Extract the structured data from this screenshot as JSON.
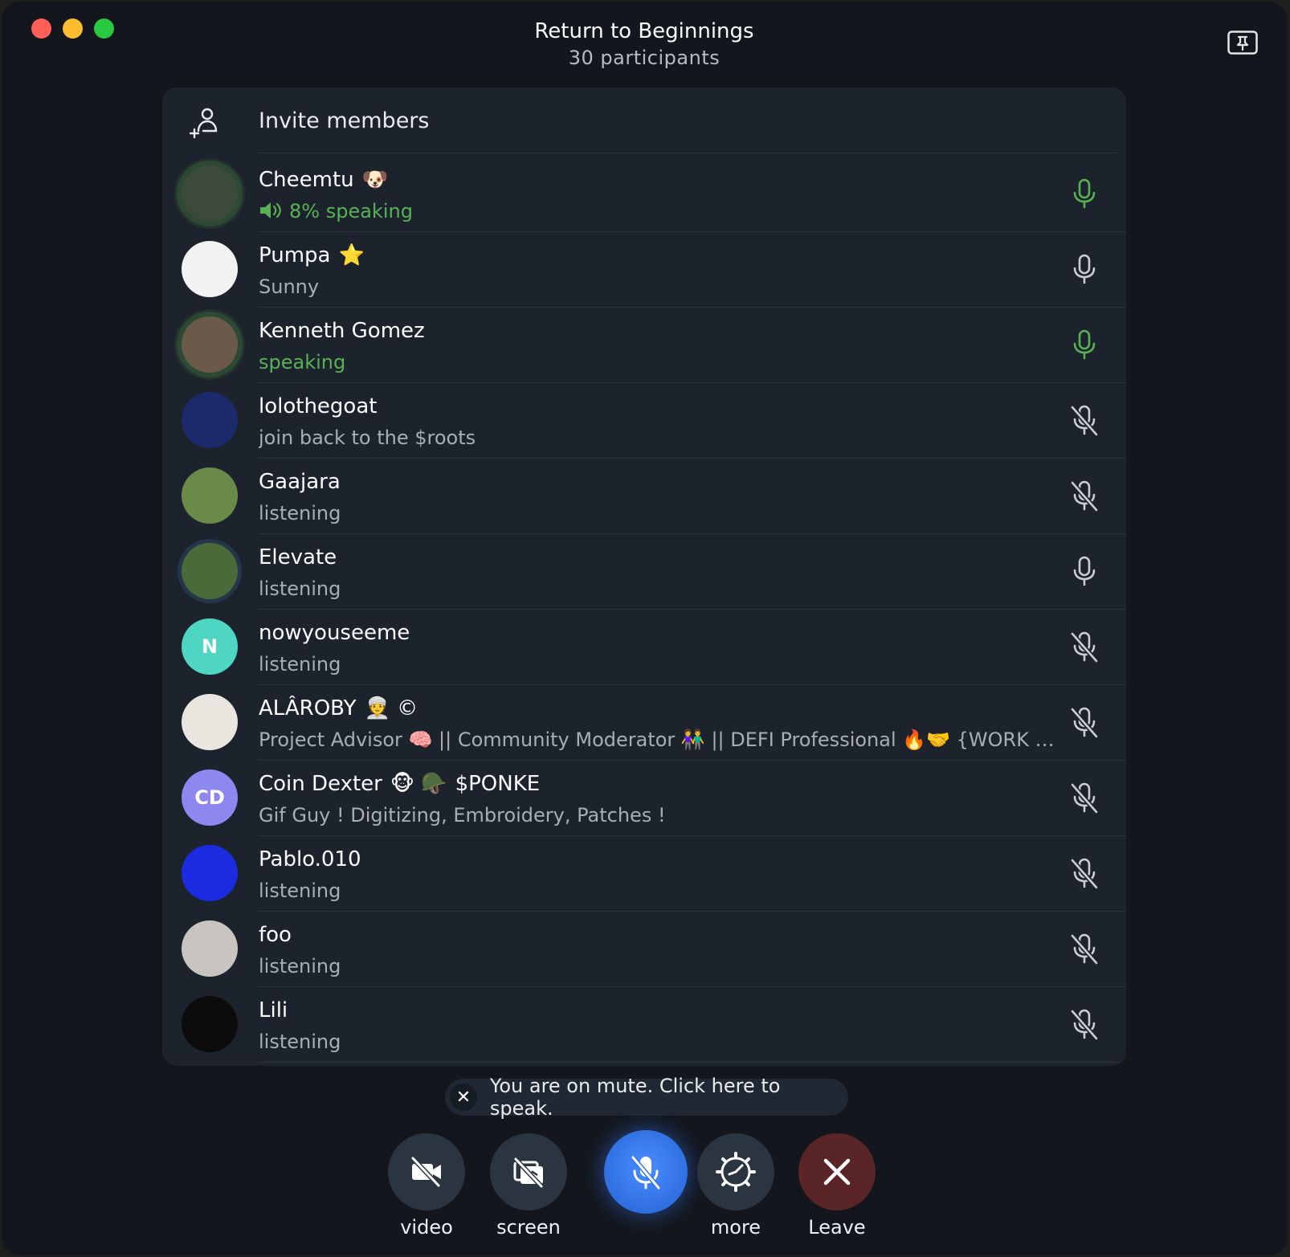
{
  "window": {
    "title": "Return to Beginnings",
    "subtitle": "30 participants"
  },
  "invite": {
    "label": "Invite members"
  },
  "participants": [
    {
      "name": "Cheemtu",
      "emoji": "🐶",
      "status": "8% speaking",
      "state": "speaking",
      "mic": "active",
      "avatar_color": "#3b4a3a",
      "initials": ""
    },
    {
      "name": "Pumpa",
      "emoji": "⭐",
      "status": "Sunny",
      "state": "idle",
      "mic": "on",
      "avatar_color": "#f2f2f2",
      "initials": ""
    },
    {
      "name": "Kenneth Gomez",
      "emoji": "",
      "status": "speaking",
      "state": "speaking",
      "mic": "active",
      "avatar_color": "#6b5a4a",
      "initials": ""
    },
    {
      "name": "lolothegoat",
      "emoji": "",
      "status": "join back to the $roots",
      "state": "idle",
      "mic": "muted",
      "avatar_color": "#1b2a6b",
      "initials": ""
    },
    {
      "name": "Gaajara",
      "emoji": "",
      "status": "listening",
      "state": "idle",
      "mic": "muted",
      "avatar_color": "#6a8a4a",
      "initials": ""
    },
    {
      "name": "Elevate",
      "emoji": "",
      "status": "listening",
      "state": "idle",
      "mic": "on",
      "avatar_color": "#4a6a3a",
      "initials": ""
    },
    {
      "name": "nowyouseeme",
      "emoji": "",
      "status": "listening",
      "state": "idle",
      "mic": "muted",
      "avatar_color": "#4fd6c2",
      "initials": "N"
    },
    {
      "name": "ALÂROBY",
      "emoji": "👳 ©",
      "status": "Project Advisor 🧠 || Community Moderator 👫 || DEFI Professional 🔥🤝 {WORK SHO...",
      "state": "idle",
      "mic": "muted",
      "avatar_color": "#e9e6e0",
      "initials": ""
    },
    {
      "name": "Coin Dexter",
      "emoji": "🐵 🪖",
      "name_suffix": "$PONKE",
      "status": "Gif Guy ! Digitizing, Embroidery, Patches !",
      "state": "idle",
      "mic": "muted",
      "avatar_color": "#8f87f0",
      "initials": "CD"
    },
    {
      "name": "Pablo.010",
      "emoji": "",
      "status": "listening",
      "state": "idle",
      "mic": "muted",
      "avatar_color": "#1a2be0",
      "initials": ""
    },
    {
      "name": "foo",
      "emoji": "",
      "status": "listening",
      "state": "idle",
      "mic": "muted",
      "avatar_color": "#c8c4c0",
      "initials": ""
    },
    {
      "name": "Lili",
      "emoji": "",
      "status": "listening",
      "state": "idle",
      "mic": "muted",
      "avatar_color": "#0c0c0c",
      "initials": ""
    }
  ],
  "toast": {
    "text": "You are on mute. Click here to speak.",
    "close": "✕"
  },
  "controls": {
    "video": "video",
    "screen": "screen",
    "more": "more",
    "leave": "Leave"
  },
  "colors": {
    "speaking_green": "#58b255",
    "mute_blue": "#3b7cf0",
    "leave_red": "#5a2527"
  }
}
